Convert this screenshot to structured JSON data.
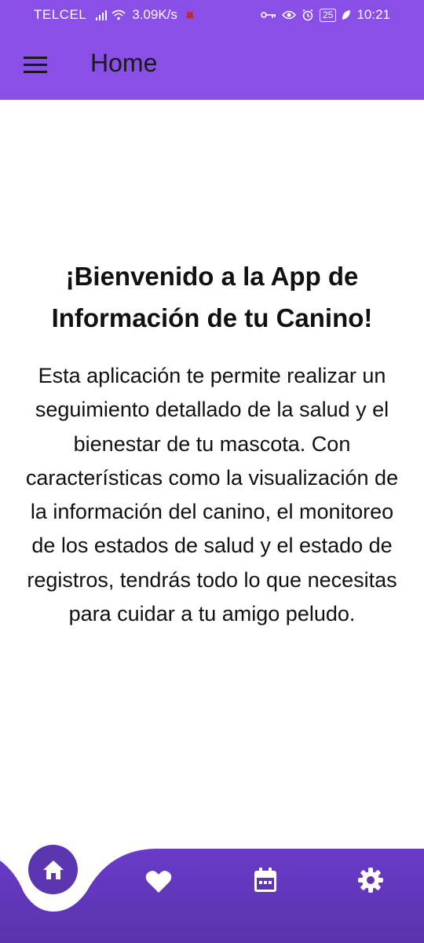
{
  "status_bar": {
    "carrier": "TELCEL",
    "network_speed": "3.09K/s",
    "battery_level": "25",
    "time": "10:21"
  },
  "app_bar": {
    "title": "Home",
    "menu_icon": "hamburger-menu-icon"
  },
  "welcome": {
    "title": "¡Bienvenido a la App de Información de tu Canino!",
    "body": "Esta aplicación te permite realizar un seguimiento detallado de la salud y el bienestar de tu mascota. Con características como la visualización de la información del canino, el monitoreo de los estados de salud y el estado de registros, tendrás todo lo que necesitas para cuidar a tu amigo peludo."
  },
  "bottom_nav": {
    "items": [
      {
        "icon": "home-icon",
        "active": true
      },
      {
        "icon": "heart-icon",
        "active": false
      },
      {
        "icon": "calendar-icon",
        "active": false
      },
      {
        "icon": "gear-icon",
        "active": false
      }
    ]
  },
  "colors": {
    "primary": "#8a4fe6",
    "nav_background": "#5c36b0",
    "text": "#111111"
  }
}
